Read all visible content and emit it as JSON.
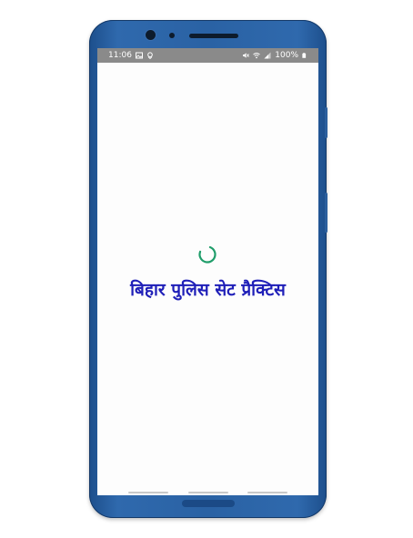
{
  "status_bar": {
    "time": "11:06",
    "battery": "100%",
    "left_icons": [
      "image-icon",
      "location-icon"
    ],
    "right_icons": [
      "mute-icon",
      "wifi-icon",
      "signal-icon",
      "battery-icon"
    ]
  },
  "app": {
    "title": "बिहार पुलिस सेट प्रैक्टिस",
    "loading": true,
    "spinner_color": "#1f9d6a",
    "title_color": "#1f1fb8"
  },
  "device": {
    "frame_color": "#2a62a4"
  }
}
